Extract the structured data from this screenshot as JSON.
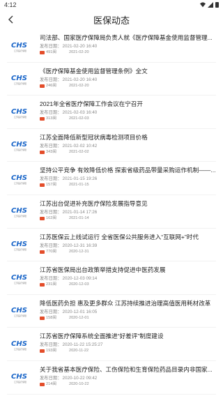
{
  "status": {
    "time": "4:12"
  },
  "header": {
    "title": "医保动态"
  },
  "thumb": {
    "logo_text": "CHS",
    "sub_text": "江苏医疗保障"
  },
  "labels": {
    "published_prefix": "发布日期：",
    "views_suffix": "阅"
  },
  "colors": {
    "logo_blue": "#1a66c9",
    "view_icon": "#e34d2a"
  },
  "items": [
    {
      "title": "司法部、国家医疗保障局负责人就《医疗保障基金使用监督管理...",
      "published": "2021-02-20 16:40",
      "views": "491",
      "date": "2021-02-20"
    },
    {
      "title": "《医疗保障基金使用监督管理条例》全文",
      "published": "2021-02-20 16:40",
      "views": "246",
      "date": "2021-02-20"
    },
    {
      "title": "2021年全省医疗保障工作会议在宁召开",
      "published": "2021-02-03 16:40",
      "views": "313",
      "date": "2021-02-03"
    },
    {
      "title": "江苏全面降低新型冠状病毒检测项目价格",
      "published": "2021-02-02 10:42",
      "views": "343",
      "date": "2021-02-02"
    },
    {
      "title": "坚持公平竞争 有效降低价格 探索省级药品带量采购运作机制——...",
      "published": "2021-01-15 19:26",
      "views": "157",
      "date": "2021-01-15"
    },
    {
      "title": "江苏出台促进补充医疗保险发展指导意见",
      "published": "2021-01-14 17:26",
      "views": "162",
      "date": "2021-01-14"
    },
    {
      "title": "江苏医保云上线试运行 全省医保公共服务进入“互联网+”时代",
      "published": "2020-12-31 16:39",
      "views": "770",
      "date": "2020-12-31"
    },
    {
      "title": "江苏省医保局出台政策举措支持促进中医药发展",
      "published": "2020-12-03 09:14",
      "views": "231",
      "date": "2020-12-03"
    },
    {
      "title": "降低医药负担 惠及更多群众 江苏持续推进治理高值医用耗材改革",
      "published": "2020-12-01 16:05",
      "views": "158",
      "date": "2020-12-01"
    },
    {
      "title": "江苏省医疗保障系统全面推进“好差评”制度建设",
      "published": "2020-11-22 15:25:27",
      "views": "193",
      "date": "2020-11-22"
    },
    {
      "title": "关于我省基本医疗保险、工伤保险和生育保险药品目录内非国家...",
      "published": "2020-10-22 09:42",
      "views": "214",
      "date": "2020-10-22"
    }
  ]
}
